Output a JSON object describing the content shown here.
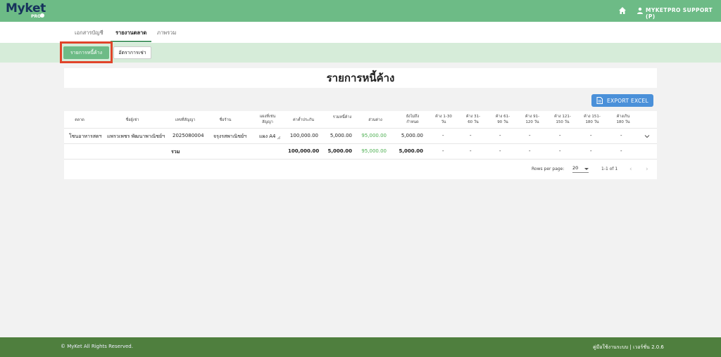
{
  "brand": {
    "name": "Myket",
    "sub": "PRO"
  },
  "header": {
    "user": "MYKETPRO SUPPORT (P)",
    "home_icon": "home-icon",
    "user_icon": "user-icon"
  },
  "tabs": [
    {
      "label": "เอกสารบัญชี"
    },
    {
      "label": "รายงานตลาด"
    },
    {
      "label": "ภาพรวม"
    }
  ],
  "subtabs": [
    {
      "label": "รายการหนี้ค้าง"
    },
    {
      "label": "อัตราการเช่า"
    }
  ],
  "page_title": "รายการหนี้ค้าง",
  "export_label": "EXPORT EXCEL",
  "table": {
    "headers": [
      [
        "ตลาด"
      ],
      [
        "ชื่อผู้เช่า"
      ],
      [
        "เลขที่สัญญา"
      ],
      [
        "ชื่อร้าน"
      ],
      [
        "แผงที่เช่น",
        "สัญญา"
      ],
      [
        "ค่าค้ำประกัน"
      ],
      [
        "รวมหนี้ค้าง"
      ],
      [
        "ส่วนต่าง"
      ],
      [
        "ยังไม่ถึง",
        "กำหนด"
      ],
      [
        "ค้าง 1-30",
        "วัน"
      ],
      [
        "ค้าง 31-",
        "60 วัน"
      ],
      [
        "ค้าง 61-",
        "90 วัน"
      ],
      [
        "ค้าง 91-",
        "120 วัน"
      ],
      [
        "ค้าง 121-",
        "150 วัน"
      ],
      [
        "ค้าง 151-",
        "180 วัน"
      ],
      [
        "ค้างเกิน",
        "180 วัน"
      ]
    ],
    "rows": [
      {
        "market": "โซนอาหารสดฯ",
        "tenant": "แพรวเพชร พัฒนาพาณิชย์ฯ",
        "contract": "2025080004",
        "shop": "จรุงรสพาณิชย์ฯ",
        "stall": "แผง A4",
        "deposit": "100,000.00",
        "total_debt": "5,000.00",
        "diff": "95,000.00",
        "not_due": "5,000.00",
        "d1_30": "-",
        "d31_60": "-",
        "d61_90": "-",
        "d91_120": "-",
        "d121_150": "-",
        "d151_180": "-",
        "d180p": "-"
      }
    ],
    "total": {
      "label": "รวม",
      "deposit": "100,000.00",
      "total_debt": "5,000.00",
      "diff": "95,000.00",
      "not_due": "5,000.00",
      "d1_30": "-",
      "d31_60": "-",
      "d61_90": "-",
      "d91_120": "-",
      "d121_150": "-",
      "d151_180": "-",
      "d180p": "-"
    }
  },
  "pagination": {
    "rows_label": "Rows per page:",
    "rows_value": "20",
    "range": "1-1 of 1",
    "prev": "‹",
    "next": "›"
  },
  "footer": {
    "left": "© MyKet All Rights Reserved.",
    "right": "คู่มือใช้งานระบบ | เวอร์ชั่น 2.0.6"
  },
  "colors": {
    "topbar": "#6dbb86",
    "footer": "#4f7f3e",
    "accent_blue": "#4a90d9",
    "green_value": "#4caf50",
    "highlight": "#e0442a"
  }
}
